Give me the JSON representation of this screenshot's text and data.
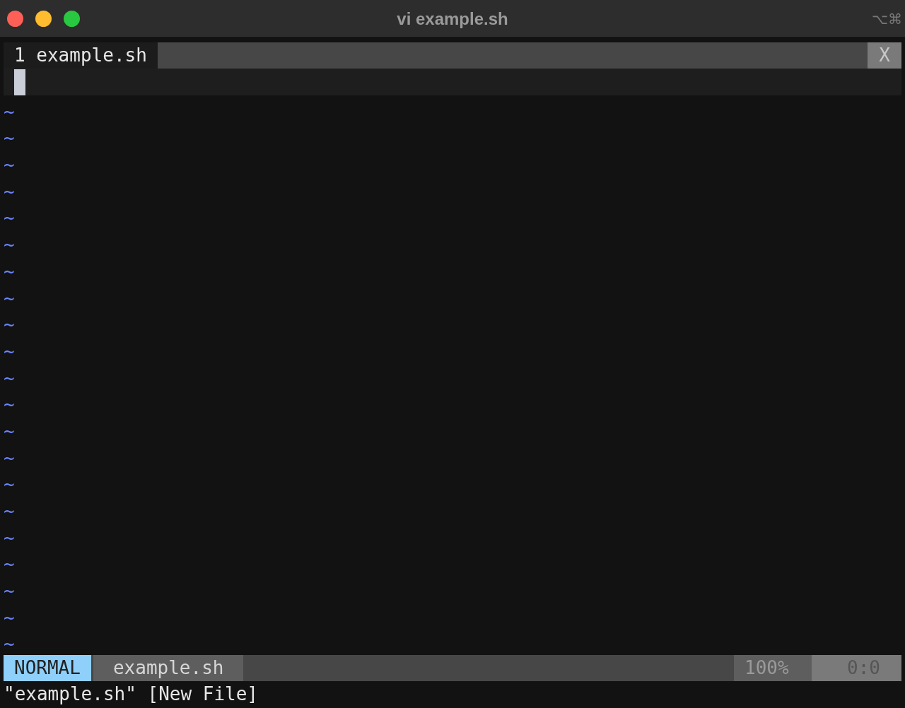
{
  "window": {
    "title": "vi example.sh",
    "shortcut": "⌥⌘"
  },
  "tabline": {
    "tabs": [
      {
        "number": "1",
        "label": "example.sh",
        "selected": true
      }
    ],
    "close": "X"
  },
  "buffer": {
    "empty_lines": [
      "~",
      "~",
      "~",
      "~",
      "~",
      "~",
      "~",
      "~",
      "~",
      "~",
      "~",
      "~",
      "~",
      "~",
      "~",
      "~",
      "~",
      "~",
      "~",
      "~",
      "~"
    ]
  },
  "status_bar": {
    "mode": "NORMAL",
    "file": "example.sh",
    "percent": "100%",
    "position": "0:0"
  },
  "message": "\"example.sh\" [New File]"
}
